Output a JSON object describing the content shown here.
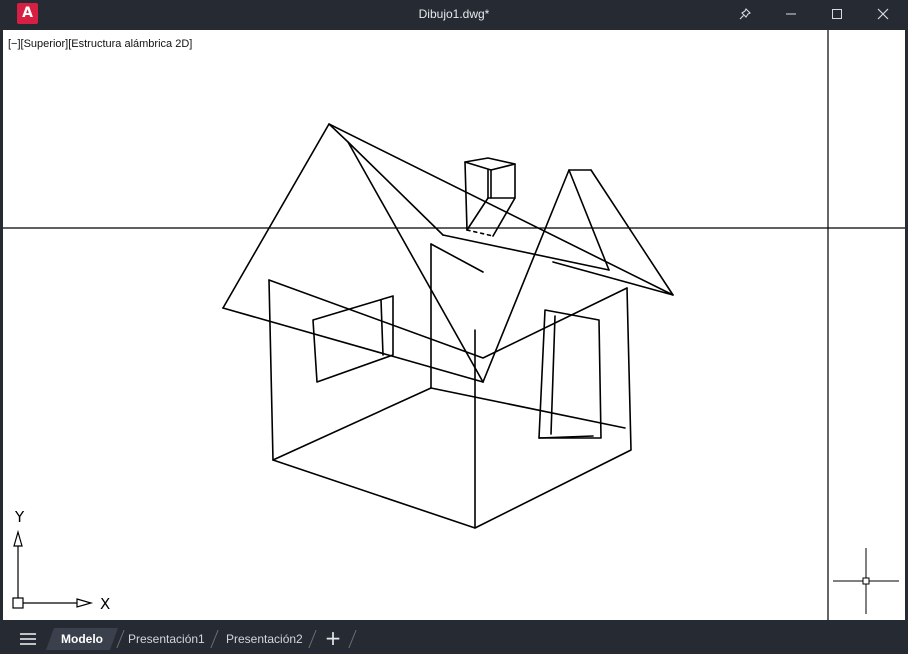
{
  "titlebar": {
    "app_logo": "A",
    "title": "Dibujo1.dwg*",
    "buttons": [
      "pin-icon",
      "minimize-icon",
      "maximize-icon",
      "close-icon"
    ]
  },
  "viewport": {
    "view_label": "[−][Superior][Estructura alámbrica 2D]",
    "ucs": {
      "x_label": "X",
      "y_label": "Y"
    }
  },
  "status_bar": {
    "tabs": [
      {
        "label": "Modelo",
        "active": true
      },
      {
        "label": "Presentación1",
        "active": false
      },
      {
        "label": "Presentación2",
        "active": false
      }
    ],
    "add_tab_label": "+"
  },
  "colors": {
    "chrome": "#262b33",
    "canvas": "#ffffff",
    "linework": "#000000",
    "logo": "#d61f42",
    "active_tab": "#3a414c"
  }
}
